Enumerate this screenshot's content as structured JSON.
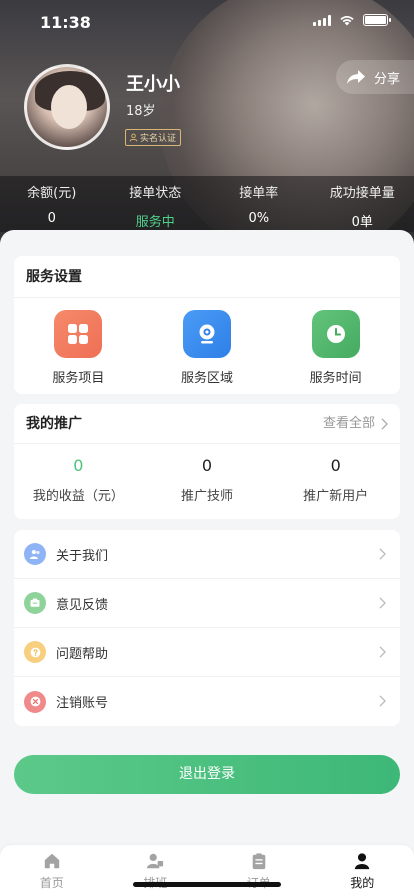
{
  "status_bar": {
    "time": "11:38"
  },
  "profile": {
    "name": "王小小",
    "age": "18岁",
    "verify_label": "实名认证",
    "share_label": "分享"
  },
  "stats": [
    {
      "label": "余额(元)",
      "value": "0"
    },
    {
      "label": "接单状态",
      "value": "服务中"
    },
    {
      "label": "接单率",
      "value": "0%"
    },
    {
      "label": "成功接单量",
      "value": "0单"
    }
  ],
  "service_settings": {
    "title": "服务设置",
    "items": [
      {
        "label": "服务项目",
        "icon": "grid-icon",
        "color": "#f07b5e"
      },
      {
        "label": "服务区域",
        "icon": "location-icon",
        "color": "#3d8ef0"
      },
      {
        "label": "服务时间",
        "icon": "clock-icon",
        "color": "#4db56a"
      }
    ]
  },
  "promotion": {
    "title": "我的推广",
    "view_all": "查看全部",
    "items": [
      {
        "value": "0",
        "label": "我的收益（元）"
      },
      {
        "value": "0",
        "label": "推广技师"
      },
      {
        "value": "0",
        "label": "推广新用户"
      }
    ]
  },
  "menu": [
    {
      "label": "关于我们",
      "icon": "users-icon",
      "color": "#8fb4f5"
    },
    {
      "label": "意见反馈",
      "icon": "feedback-icon",
      "color": "#8ed39a"
    },
    {
      "label": "问题帮助",
      "icon": "help-icon",
      "color": "#f7cf7e"
    },
    {
      "label": "注销账号",
      "icon": "close-icon",
      "color": "#f08a8a"
    }
  ],
  "logout_label": "退出登录",
  "tabbar": [
    {
      "label": "首页",
      "icon": "home-icon"
    },
    {
      "label": "排班",
      "icon": "schedule-icon"
    },
    {
      "label": "订单",
      "icon": "order-icon"
    },
    {
      "label": "我的",
      "icon": "person-icon",
      "active": true
    }
  ],
  "colors": {
    "accent_green": "#4fc27a",
    "status_green": "#4fd18b"
  }
}
